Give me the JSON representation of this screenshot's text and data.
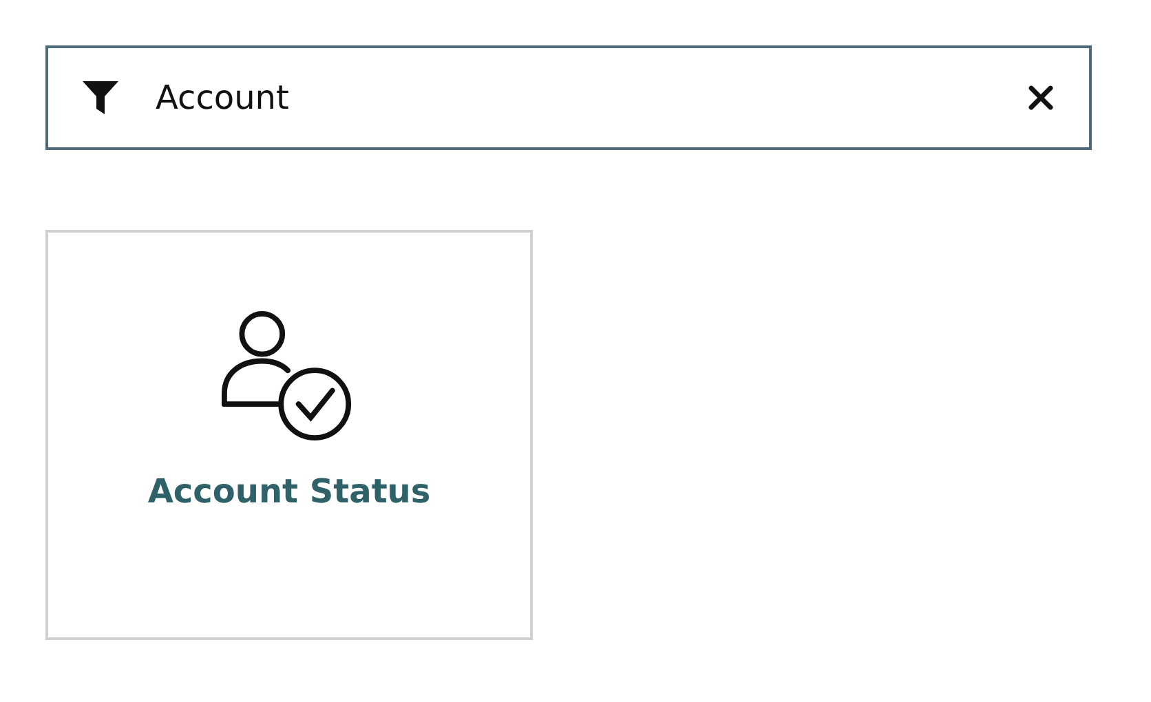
{
  "filter": {
    "value": "Account"
  },
  "tiles": [
    {
      "title": "Account Status"
    }
  ]
}
